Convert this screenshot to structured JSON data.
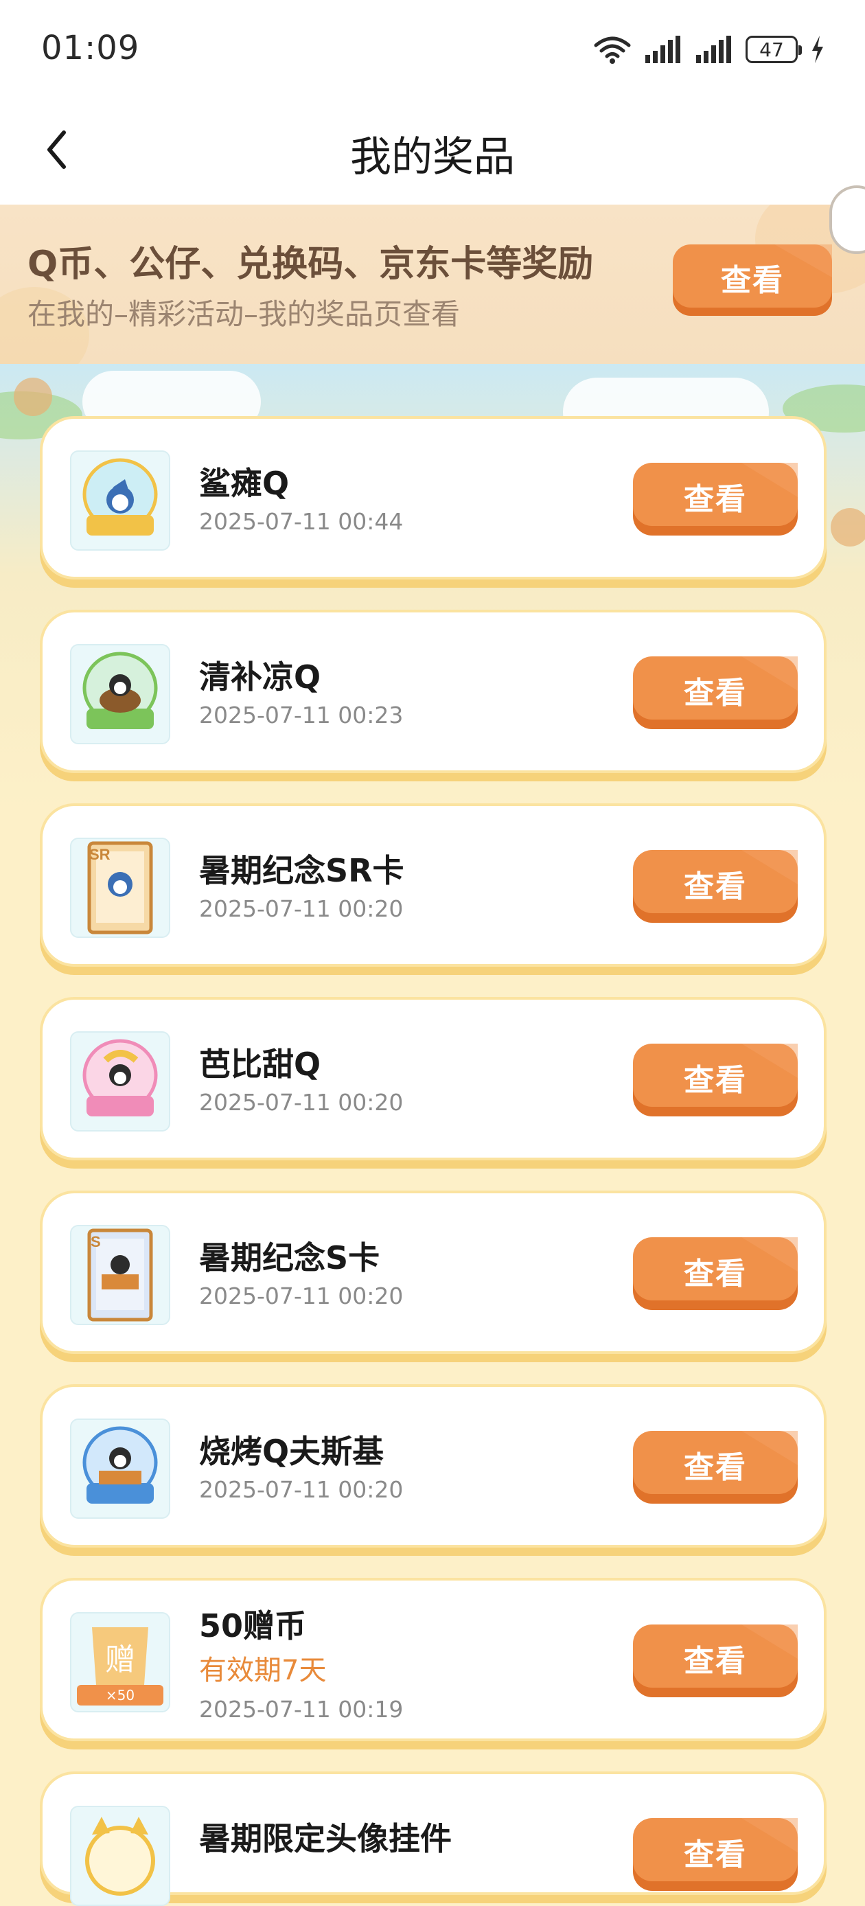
{
  "status_bar": {
    "time": "01:09",
    "battery": "47"
  },
  "nav": {
    "title": "我的奖品"
  },
  "banner": {
    "title": "Q币、公仔、兑换码、京东卡等奖励",
    "subtitle": "在我的–精彩活动–我的奖品页查看",
    "button_label": "查看"
  },
  "prizes": [
    {
      "name": "鲨瘫Q",
      "date": "2025-07-11 00:44",
      "button_label": "查看",
      "icon": "shark-penguin-figure-icon"
    },
    {
      "name": "清补凉Q",
      "date": "2025-07-11 00:23",
      "button_label": "查看",
      "icon": "coconut-penguin-figure-icon"
    },
    {
      "name": "暑期纪念SR卡",
      "date": "2025-07-11 00:20",
      "button_label": "查看",
      "icon": "sr-card-icon",
      "badge": "SR"
    },
    {
      "name": "芭比甜Q",
      "date": "2025-07-11 00:20",
      "button_label": "查看",
      "icon": "barbie-penguin-figure-icon"
    },
    {
      "name": "暑期纪念S卡",
      "date": "2025-07-11 00:20",
      "button_label": "查看",
      "icon": "s-card-icon",
      "badge": "S"
    },
    {
      "name": "烧烤Q夫斯基",
      "date": "2025-07-11 00:20",
      "button_label": "查看",
      "icon": "bbq-penguin-figure-icon"
    },
    {
      "name": "50赠币",
      "validity": "有效期7天",
      "date": "2025-07-11 00:19",
      "button_label": "查看",
      "icon": "gift-coin-icon",
      "coin_char": "赠",
      "coin_qty": "×50"
    },
    {
      "name": "暑期限定头像挂件",
      "button_label": "查看",
      "icon": "avatar-frame-icon"
    }
  ],
  "colors": {
    "button": "#f0914a",
    "button_dark": "#e0722a",
    "card_border": "#fbe3a0",
    "accent_text": "#e88a3a"
  }
}
